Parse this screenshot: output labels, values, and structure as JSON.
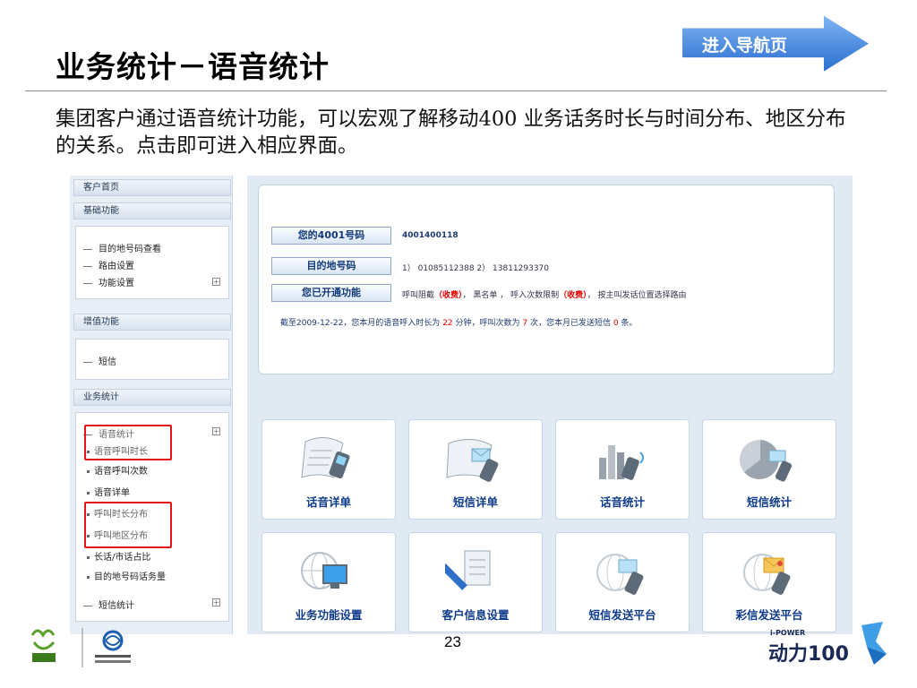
{
  "slide": {
    "title": "业务统计－语音统计",
    "nav_button": "进入导航页",
    "intro": "集团客户通过语音统计功能，可以宏观了解移动400 业务话务时长与时间分布、地区分布的关系。点击即可进入相应界面。",
    "page_number": "23"
  },
  "sidebar": {
    "home": "客户首页",
    "basic_header": "基础功能",
    "basic_items": [
      "目的地号码查看",
      "路由设置",
      "功能设置"
    ],
    "vas_header": "增值功能",
    "vas_items": [
      "短信"
    ],
    "stats_header": "业务统计",
    "voice_stats": "语音统计",
    "voice_sub": [
      "语音呼叫时长",
      "语音呼叫次数",
      "语音详单",
      "呼叫时长分布",
      "呼叫地区分布",
      "长话/市话占比",
      "目的地号码话务量"
    ],
    "sms_stats": "短信统计",
    "expand_symbol": "+"
  },
  "info": {
    "number_label": "您的4001号码",
    "number_value": "4001400118",
    "dest_label": "目的地号码",
    "dest_value": "1） 01085112388   2） 13811293370",
    "features_label": "您已开通功能",
    "feat_1": "呼叫阻截",
    "feat_1_fee": "（收费）",
    "feat_2": "，  黑名单  ，  呼入次数限制",
    "feat_2_fee": "（收费）",
    "feat_3": "，  按主叫发话位置选择路由",
    "summary_pre": "截至2009-12-22，您本月的语音呼入时长为",
    "summary_minutes": "22",
    "summary_mid1": "分钟，呼叫次数为",
    "summary_calls": "7",
    "summary_mid2": "次，您本月已发送短信",
    "summary_sms": "0",
    "summary_post": "条。"
  },
  "tiles": [
    "话音详单",
    "短信详单",
    "话音统计",
    "短信统计",
    "业务功能设置",
    "客户信息设置",
    "短信发送平台",
    "彩信发送平台"
  ],
  "footer": {
    "right_brand_top": "i-POWER",
    "right_brand_main": "动力100"
  },
  "colors": {
    "accent_blue": "#3a7fd9",
    "highlight_red": "#e01515",
    "tile_text": "#0e3b8c"
  }
}
